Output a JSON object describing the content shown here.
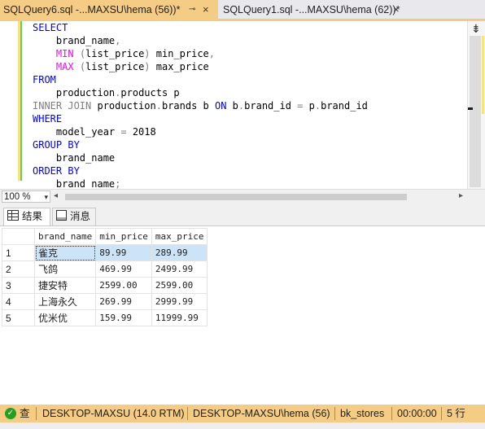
{
  "tabs": [
    {
      "title": "SQLQuery6.sql -...MAXSU\\hema (56))*",
      "pin": "⊸",
      "close": "×"
    },
    {
      "title": "SQLQuery1.sql -...MAXSU\\hema (62))*",
      "close": "×"
    }
  ],
  "editor": {
    "lines": [
      [
        {
          "t": "SELECT",
          "c": "kw"
        }
      ],
      [
        {
          "t": "    brand_name",
          "c": "tx"
        },
        {
          "t": ",",
          "c": "gr"
        }
      ],
      [
        {
          "t": "    ",
          "c": "tx"
        },
        {
          "t": "MIN",
          "c": "fn"
        },
        {
          "t": " (",
          "c": "gr"
        },
        {
          "t": "list_price",
          "c": "tx"
        },
        {
          "t": ")",
          "c": "gr"
        },
        {
          "t": " min_price",
          "c": "tx"
        },
        {
          "t": ",",
          "c": "gr"
        }
      ],
      [
        {
          "t": "    ",
          "c": "tx"
        },
        {
          "t": "MAX",
          "c": "fn"
        },
        {
          "t": " (",
          "c": "gr"
        },
        {
          "t": "list_price",
          "c": "tx"
        },
        {
          "t": ")",
          "c": "gr"
        },
        {
          "t": " max_price",
          "c": "tx"
        }
      ],
      [
        {
          "t": "FROM",
          "c": "kw"
        }
      ],
      [
        {
          "t": "    production",
          "c": "tx"
        },
        {
          "t": ".",
          "c": "gr"
        },
        {
          "t": "products p",
          "c": "tx"
        }
      ],
      [
        {
          "t": "INNER JOIN",
          "c": "gr"
        },
        {
          "t": " production",
          "c": "tx"
        },
        {
          "t": ".",
          "c": "gr"
        },
        {
          "t": "brands b ",
          "c": "tx"
        },
        {
          "t": "ON",
          "c": "kw"
        },
        {
          "t": " b",
          "c": "tx"
        },
        {
          "t": ".",
          "c": "gr"
        },
        {
          "t": "brand_id ",
          "c": "tx"
        },
        {
          "t": "=",
          "c": "gr"
        },
        {
          "t": " p",
          "c": "tx"
        },
        {
          "t": ".",
          "c": "gr"
        },
        {
          "t": "brand_id",
          "c": "tx"
        }
      ],
      [
        {
          "t": "WHERE",
          "c": "kw"
        }
      ],
      [
        {
          "t": "    model_year ",
          "c": "tx"
        },
        {
          "t": "=",
          "c": "gr"
        },
        {
          "t": " 2018",
          "c": "tx"
        }
      ],
      [
        {
          "t": "GROUP BY",
          "c": "kw"
        }
      ],
      [
        {
          "t": "    brand_name",
          "c": "tx"
        }
      ],
      [
        {
          "t": "ORDER BY",
          "c": "kw"
        }
      ],
      [
        {
          "t": "    brand_name",
          "c": "tx"
        },
        {
          "t": ";",
          "c": "gr"
        }
      ]
    ],
    "split_icon": "⇟"
  },
  "zoom": {
    "value": "100 %",
    "arrow": "▾",
    "left_arrow": "◂",
    "right_arrow": "▸"
  },
  "result_tabs": {
    "results": "结果",
    "messages": "消息"
  },
  "grid": {
    "columns": [
      "brand_name",
      "min_price",
      "max_price"
    ],
    "rows": [
      {
        "n": "1",
        "brand_name": "雀克",
        "min_price": "89.99",
        "max_price": "289.99"
      },
      {
        "n": "2",
        "brand_name": "飞鸽",
        "min_price": "469.99",
        "max_price": "2499.99"
      },
      {
        "n": "3",
        "brand_name": "捷安特",
        "min_price": "2599.00",
        "max_price": "2599.00"
      },
      {
        "n": "4",
        "brand_name": "上海永久",
        "min_price": "269.99",
        "max_price": "2999.99"
      },
      {
        "n": "5",
        "brand_name": "优米优",
        "min_price": "159.99",
        "max_price": "11999.99"
      }
    ]
  },
  "status": {
    "icon": "✓",
    "state": "查",
    "server": "DESKTOP-MAXSU (14.0 RTM)",
    "login": "DESKTOP-MAXSU\\hema (56)",
    "database": "bk_stores",
    "elapsed": "00:00:00",
    "rows": "5 行"
  },
  "colors": {
    "accent": "#f5cc84",
    "keyword": "#0000ff",
    "function": "#ff00ff",
    "operator": "#808080",
    "selection": "#cce4f7"
  }
}
